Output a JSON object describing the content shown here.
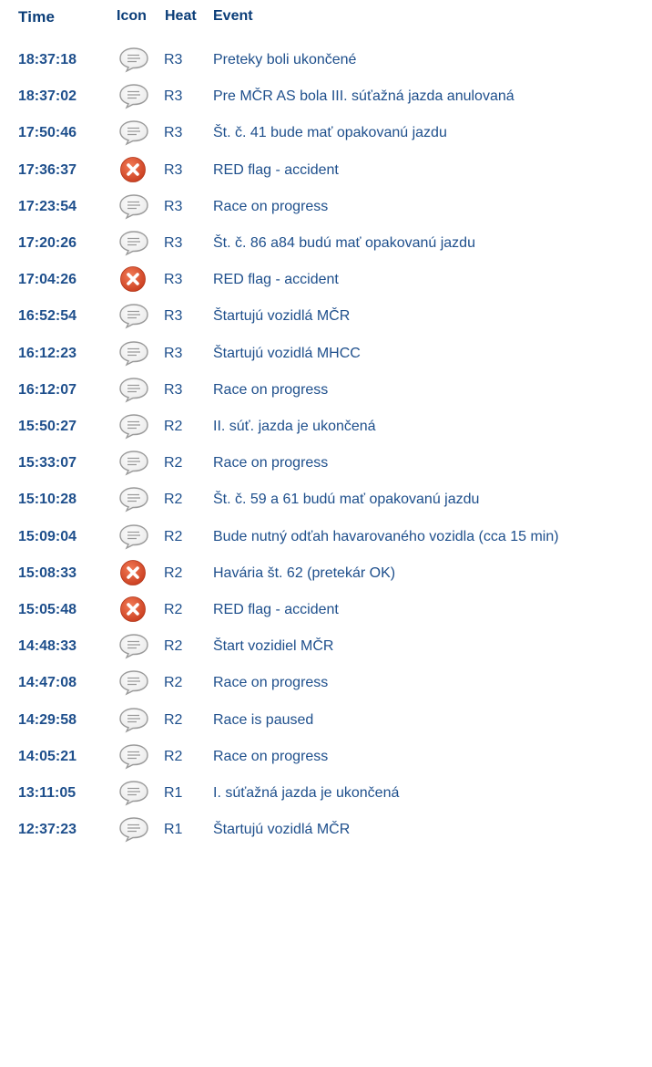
{
  "header": {
    "time": "Time",
    "icon": "Icon",
    "heat": "Heat",
    "event": "Event"
  },
  "rows": [
    {
      "time": "18:37:18",
      "icon": "speech-bubble-icon",
      "heat": "R3",
      "event": "Preteky boli ukončené"
    },
    {
      "time": "18:37:02",
      "icon": "speech-bubble-icon",
      "heat": "R3",
      "event": "Pre MČR AS bola III. súťažná jazda anulovaná"
    },
    {
      "time": "17:50:46",
      "icon": "speech-bubble-icon",
      "heat": "R3",
      "event": "Št. č. 41 bude mať opakovanú jazdu"
    },
    {
      "time": "17:36:37",
      "icon": "red-cross-icon",
      "heat": "R3",
      "event": "RED flag - accident"
    },
    {
      "time": "17:23:54",
      "icon": "speech-bubble-icon",
      "heat": "R3",
      "event": "Race on progress"
    },
    {
      "time": "17:20:26",
      "icon": "speech-bubble-icon",
      "heat": "R3",
      "event": "Št. č. 86 a84 budú mať opakovanú jazdu"
    },
    {
      "time": "17:04:26",
      "icon": "red-cross-icon",
      "heat": "R3",
      "event": "RED flag - accident"
    },
    {
      "time": "16:52:54",
      "icon": "speech-bubble-icon",
      "heat": "R3",
      "event": "Štartujú vozidlá MČR"
    },
    {
      "time": "16:12:23",
      "icon": "speech-bubble-icon",
      "heat": "R3",
      "event": "Štartujú vozidlá MHCC"
    },
    {
      "time": "16:12:07",
      "icon": "speech-bubble-icon",
      "heat": "R3",
      "event": "Race on progress"
    },
    {
      "time": "15:50:27",
      "icon": "speech-bubble-icon",
      "heat": "R2",
      "event": "II. súť. jazda je ukončená"
    },
    {
      "time": "15:33:07",
      "icon": "speech-bubble-icon",
      "heat": "R2",
      "event": "Race on progress"
    },
    {
      "time": "15:10:28",
      "icon": "speech-bubble-icon",
      "heat": "R2",
      "event": "Št. č. 59 a 61 budú mať opakovanú jazdu"
    },
    {
      "time": "15:09:04",
      "icon": "speech-bubble-icon",
      "heat": "R2",
      "event": "Bude nutný odťah havarovaného vozidla (cca 15 min)"
    },
    {
      "time": "15:08:33",
      "icon": "red-cross-icon",
      "heat": "R2",
      "event": "Havária št. 62 (pretekár OK)"
    },
    {
      "time": "15:05:48",
      "icon": "red-cross-icon",
      "heat": "R2",
      "event": "RED flag - accident"
    },
    {
      "time": "14:48:33",
      "icon": "speech-bubble-icon",
      "heat": "R2",
      "event": "Štart vozidiel MČR"
    },
    {
      "time": "14:47:08",
      "icon": "speech-bubble-icon",
      "heat": "R2",
      "event": "Race on progress"
    },
    {
      "time": "14:29:58",
      "icon": "speech-bubble-icon",
      "heat": "R2",
      "event": "Race is paused"
    },
    {
      "time": "14:05:21",
      "icon": "speech-bubble-icon",
      "heat": "R2",
      "event": "Race on progress"
    },
    {
      "time": "13:11:05",
      "icon": "speech-bubble-icon",
      "heat": "R1",
      "event": "I. súťažná jazda je ukončená"
    },
    {
      "time": "12:37:23",
      "icon": "speech-bubble-icon",
      "heat": "R1",
      "event": "Štartujú vozidlá MČR"
    }
  ],
  "colors": {
    "header_text": "#0a3d78",
    "row_text": "#1e4f8c",
    "red_icon": "#d9482b",
    "bubble_stroke": "#9a9a9a"
  }
}
